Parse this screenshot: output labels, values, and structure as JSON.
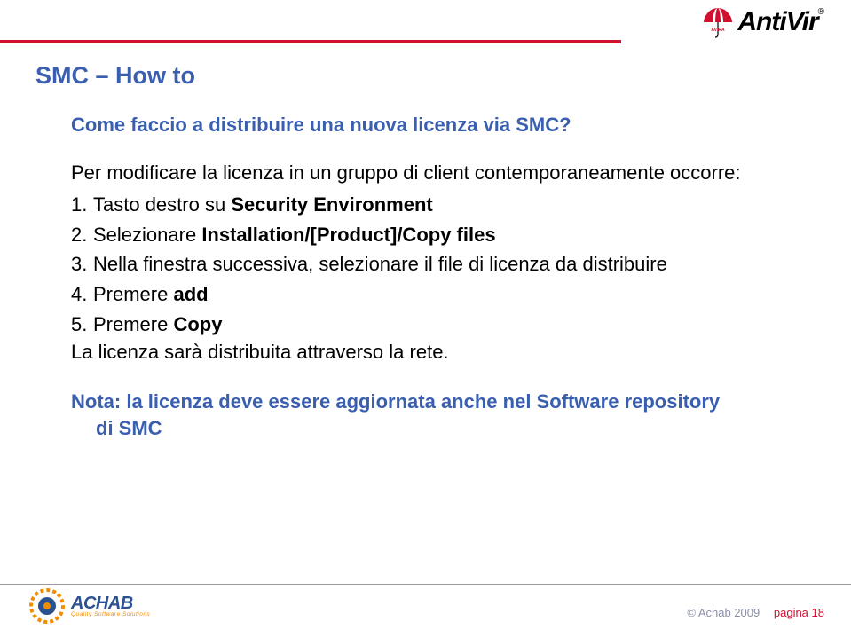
{
  "brand": {
    "name": "AntiVir",
    "vendor": "AVIRA",
    "registered": "®"
  },
  "slide": {
    "title": "SMC – How to",
    "question": "Come faccio a distribuire una nuova licenza via SMC?",
    "intro": "Per modificare la licenza in un gruppo di client contemporaneamente occorre:",
    "steps": [
      {
        "num": "1.",
        "pre": "Tasto destro su ",
        "bold": "Security Environment",
        "post": ""
      },
      {
        "num": "2.",
        "pre": "Selezionare ",
        "bold": "Installation/[Product]/Copy files",
        "post": ""
      },
      {
        "num": "3.",
        "pre": "Nella finestra successiva, selezionare il file di licenza da distribuire",
        "bold": "",
        "post": ""
      },
      {
        "num": "4.",
        "pre": "Premere ",
        "bold": "add",
        "post": ""
      },
      {
        "num": "5.",
        "pre": "Premere ",
        "bold": "Copy",
        "post": ""
      }
    ],
    "after": "La licenza sarà distribuita attraverso la rete.",
    "note_line1": "Nota: la licenza deve essere aggiornata anche nel Software repository",
    "note_line2": "di SMC"
  },
  "footer": {
    "company": "ACHAB",
    "tagline": "Quality Software Solutions",
    "copyright": "© Achab 2009",
    "page_label": "pagina 18"
  }
}
